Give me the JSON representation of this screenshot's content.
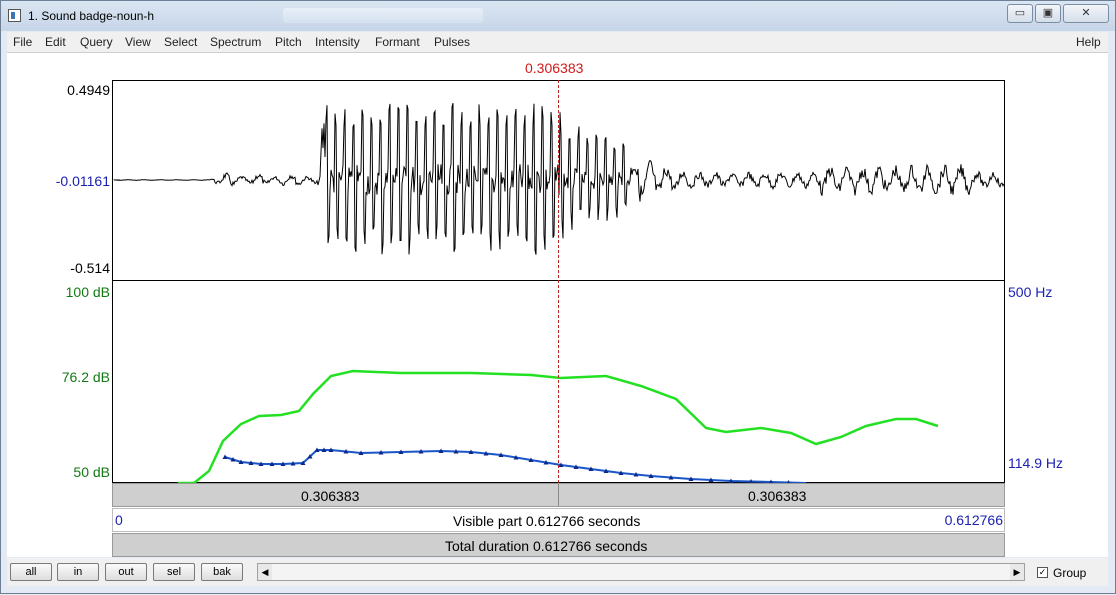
{
  "window": {
    "title": "1. Sound badge-noun-h",
    "min_glyph": "▭",
    "max_glyph": "▣",
    "close_glyph": "✕"
  },
  "menu": [
    "File",
    "Edit",
    "Query",
    "View",
    "Select",
    "Spectrum",
    "Pitch",
    "Intensity",
    "Formant",
    "Pulses",
    "Help"
  ],
  "cursor_time": "0.306383",
  "waveform": {
    "max_label": "0.4949",
    "zero_label": "-0.01161",
    "min_label": "-0.514"
  },
  "intensity": {
    "top_label": "100 dB",
    "mid_label": "76.2 dB",
    "bottom_label": "50 dB",
    "color": "#22e022"
  },
  "pitch": {
    "top_label": "500 Hz",
    "bottom_label": "114.9 Hz",
    "color": "#1a56c8"
  },
  "bars": {
    "left_segment": "0.306383",
    "right_segment": "0.306383",
    "visible_start": "0",
    "visible_label": "Visible part 0.612766 seconds",
    "visible_end": "0.612766",
    "total_label": "Total duration 0.612766 seconds"
  },
  "buttons": {
    "all": "all",
    "in": "in",
    "out": "out",
    "sel": "sel",
    "bak": "bak"
  },
  "group_label": "Group",
  "group_checked": true
}
